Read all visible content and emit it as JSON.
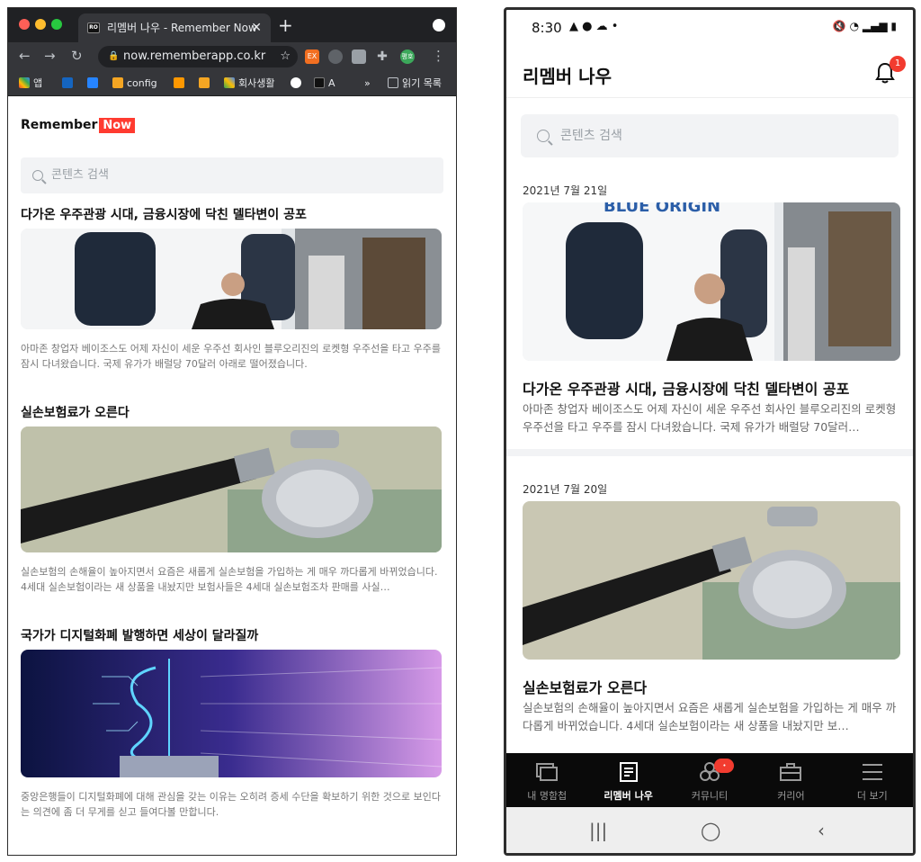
{
  "desktop": {
    "tab_title": "리멤버 나우 - Remember Now",
    "tab_favicon": "RO",
    "url": "now.rememberapp.co.kr",
    "bookmarks": {
      "apps": "앱",
      "config": "config",
      "company_life": "회사생활",
      "a": "A",
      "reading_list": "읽기 목록",
      "more": "»"
    },
    "profile_initials": "평호",
    "logo_text": "Remember",
    "logo_badge": "Now",
    "search_placeholder": "콘텐츠 검색",
    "articles": [
      {
        "title": "다가온 우주관광 시대, 금융시장에 닥친 델타변이 공포",
        "desc": "아마존 창업자 베이조스도 어제 자신이 세운 우주선 회사인 블루오리진의 로켓형 우주선을 타고 우주를 잠시 다녀왔습니다. 국제 유가가 배럴당 70달러 아래로 떨어졌습니다."
      },
      {
        "title": "실손보험료가 오른다",
        "desc": "실손보험의 손해율이 높아지면서 요즘은 새롭게 실손보험을 가입하는 게 매우 까다롭게 바뀌었습니다. 4세대 실손보험이라는 새 상품을 내놨지만 보험사들은 4세대 실손보험조차 판매를 사실…"
      },
      {
        "title": "국가가 디지털화폐 발행하면 세상이 달라질까",
        "desc": "중앙은행들이 디지털화폐에 대해 관심을 갖는 이유는 오히려 증세 수단을 확보하기 위한 것으로 보인다는 의견에 좀 더 무게를 싣고 들여다볼 만합니다."
      }
    ]
  },
  "phone": {
    "status_time": "8:30",
    "app_title": "리멤버 나우",
    "notification_count": "1",
    "search_placeholder": "콘텐츠 검색",
    "articles": [
      {
        "date": "2021년 7월 21일",
        "title": "다가온 우주관광 시대, 금융시장에 닥친 델타변이 공포",
        "desc": "아마존 창업자 베이조스도 어제 자신이 세운 우주선 회사인 블루오리진의 로켓형 우주선을 타고 우주를 잠시 다녀왔습니다. 국제 유가가 배럴당 70달러…",
        "image_text": "BLUE ORIGIN"
      },
      {
        "date": "2021년 7월 20일",
        "title": "실손보험료가 오른다",
        "desc": "실손보험의 손해율이 높아지면서 요즘은 새롭게 실손보험을 가입하는 게 매우 까다롭게 바뀌었습니다. 4세대 실손보험이라는 새 상품을 내놨지만 보…"
      }
    ],
    "bottom_nav": [
      {
        "label": "내 명함첩",
        "icon": "cards-icon"
      },
      {
        "label": "리멤버 나우",
        "icon": "article-icon"
      },
      {
        "label": "커뮤니티",
        "icon": "community-icon"
      },
      {
        "label": "커리어",
        "icon": "briefcase-icon"
      },
      {
        "label": "더 보기",
        "icon": "menu-icon"
      }
    ],
    "community_badge": "•"
  },
  "colors": {
    "brand_red": "#ff3b30",
    "badge_red": "#f23b2f",
    "chrome_dark": "#202124",
    "chrome_toolbar": "#35363a"
  }
}
